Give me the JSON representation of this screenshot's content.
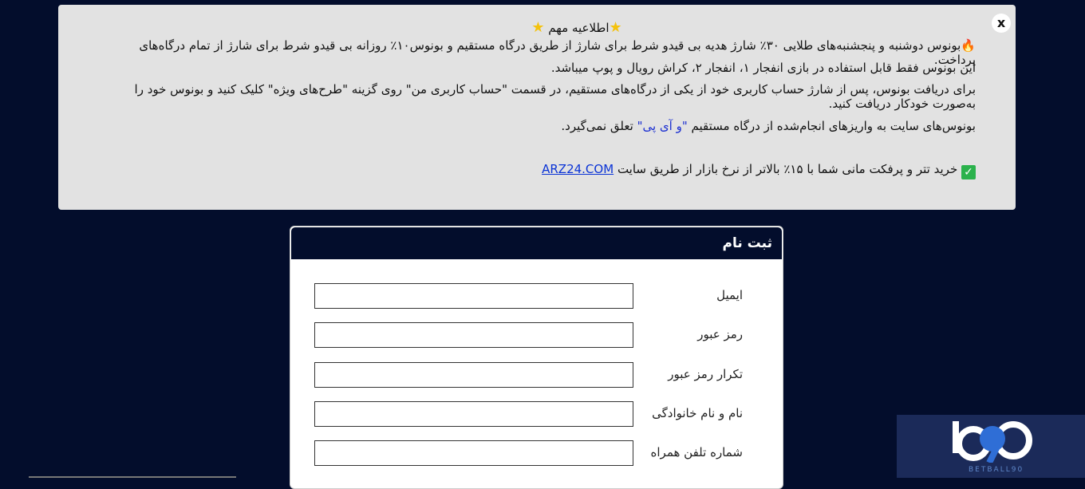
{
  "notice": {
    "close_label": "x",
    "title": "اطلاعیه مهم",
    "line1": "بونوس دوشنبه و پنجشنبه‌های طلایی ۳۰٪ شارژ هدیه بی قیدو شرط برای شارژ از طریق درگاه مستقیم و بونوس۱۰٪ روزانه بی قیدو شرط برای شارژ از تمام درگاه‌های پرداخت.",
    "line2": "این بونوس فقط قابل استفاده در بازی انفجار ۱، انفجار ۲، کراش رویال و پوپ میباشد.",
    "line3": "برای دریافت بونوس، پس از شارژ حساب کاربری خود از یکی از درگاه‌های مستقیم، در قسمت \"حساب کاربری من\" روی گزینه \"طرح‌های ویژه\" کلیک کنید و بونوس خود را به‌صورت خودکار دریافت کنید.",
    "line4_pre": "بونوس‌های سایت به واریزهای انجام‌شده از درگاه مستقیم",
    "line4_vip": "\"و آی پی\"",
    "line4_post": "تعلق نمی‌گیرد.",
    "line5_text": "خرید تتر و پرفکت مانی شما با ۱۵٪ بالاتر از نرخ بازار از طریق سایت",
    "line5_link": "ARZ24.COM"
  },
  "register": {
    "title": "ثبت نام",
    "fields": [
      {
        "label": "ایمیل"
      },
      {
        "label": "رمز عبور"
      },
      {
        "label": "تکرار رمز عبور"
      },
      {
        "label": "نام و نام خانوادگی"
      },
      {
        "label": "شماره تلفن همراه"
      }
    ]
  },
  "logo": {
    "text": "BETBALL90"
  },
  "colors": {
    "background": "#030d2c",
    "notice_bg": "#e2e2e2",
    "link": "#0b34d6"
  }
}
